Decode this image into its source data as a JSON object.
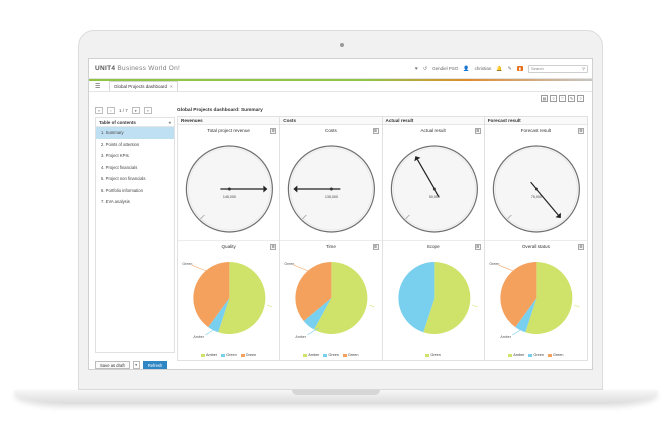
{
  "app": {
    "brand_prefix": "UNIT4",
    "brand_name": "Business World On!"
  },
  "topbar": {
    "user": "christian",
    "company": "Gendiel PSO",
    "search_placeholder": "Search"
  },
  "tab": {
    "label": "Global Projects dashboard",
    "close": "×"
  },
  "pager": {
    "position": "1 / 7"
  },
  "toc": {
    "title": "Table of contents",
    "items": [
      "1. Summary",
      "2. Points of attention",
      "3. Project KPIs",
      "4. Project financials",
      "5. Project non financials",
      "6. Portfolio information",
      "7. EVA analysis"
    ],
    "selected_index": 0
  },
  "dashboard": {
    "title": "Global Projects dashboard: Summary",
    "columns": [
      {
        "header": "Revenues",
        "gauge_title": "Total project revenue",
        "gauge_value": "145,000",
        "needle_angle": 90,
        "pie_title": "Quality"
      },
      {
        "header": "Costs",
        "gauge_title": "Costs",
        "gauge_value": "135,000",
        "needle_angle": -90,
        "pie_title": "Time"
      },
      {
        "header": "Actual result",
        "gauge_title": "Actual result",
        "gauge_value": "50,000",
        "needle_angle": -30,
        "pie_title": "Scope"
      },
      {
        "header": "Forecast result",
        "gauge_title": "Forecast result",
        "gauge_value": "75,000",
        "needle_angle": 140,
        "pie_title": "Overall status"
      }
    ]
  },
  "colors": {
    "green": "#cfe26a",
    "amber": "#f4a15e",
    "blue": "#79cfee",
    "accent": "#2f86c4"
  },
  "chart_data": [
    {
      "type": "pie",
      "title": "Quality",
      "categories": [
        "Green",
        "Amber",
        "Green"
      ],
      "values": [
        0.55,
        0.05,
        0.4
      ],
      "legend": [
        "Amber",
        "Green"
      ],
      "outside_labels": [
        "Green",
        "Amber"
      ]
    },
    {
      "type": "pie",
      "title": "Time",
      "categories": [
        "Green",
        "Amber",
        "Green"
      ],
      "values": [
        0.58,
        0.06,
        0.36
      ],
      "legend": [
        "Amber",
        "Green"
      ],
      "outside_labels": [
        "Green",
        "Amber"
      ]
    },
    {
      "type": "pie",
      "title": "Scope",
      "categories": [
        "Green",
        "Blue"
      ],
      "values": [
        0.55,
        0.45
      ],
      "legend": [
        "Green"
      ],
      "outside_labels": []
    },
    {
      "type": "pie",
      "title": "Overall status",
      "categories": [
        "Green",
        "Amber",
        "Green"
      ],
      "values": [
        0.55,
        0.05,
        0.4
      ],
      "legend": [
        "Amber",
        "Green"
      ],
      "outside_labels": [
        "Green",
        "Amber"
      ]
    }
  ],
  "buttons": {
    "save_draft": "Save as draft",
    "refresh": "Refresh"
  }
}
